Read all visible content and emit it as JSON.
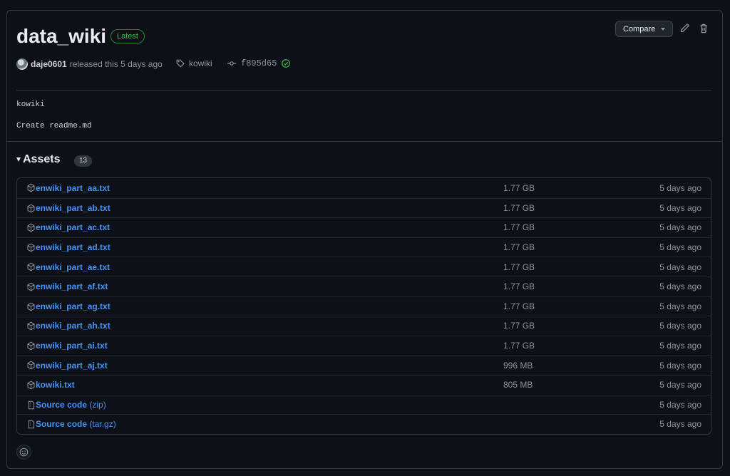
{
  "release": {
    "title": "data_wiki",
    "badge": "Latest",
    "compare_label": "Compare",
    "author": "daje0601",
    "released_text": "released this 5 days ago",
    "tag": "kowiki",
    "commit": "f895d65",
    "notes": [
      "kowiki",
      "Create readme.md"
    ]
  },
  "assets": {
    "heading": "Assets",
    "count": "13",
    "items": [
      {
        "name": "enwiki_part_aa.txt",
        "sub": "",
        "size": "1.77 GB",
        "date": "5 days ago",
        "icon": "package-icon"
      },
      {
        "name": "enwiki_part_ab.txt",
        "sub": "",
        "size": "1.77 GB",
        "date": "5 days ago",
        "icon": "package-icon"
      },
      {
        "name": "enwiki_part_ac.txt",
        "sub": "",
        "size": "1.77 GB",
        "date": "5 days ago",
        "icon": "package-icon"
      },
      {
        "name": "enwiki_part_ad.txt",
        "sub": "",
        "size": "1.77 GB",
        "date": "5 days ago",
        "icon": "package-icon"
      },
      {
        "name": "enwiki_part_ae.txt",
        "sub": "",
        "size": "1.77 GB",
        "date": "5 days ago",
        "icon": "package-icon"
      },
      {
        "name": "enwiki_part_af.txt",
        "sub": "",
        "size": "1.77 GB",
        "date": "5 days ago",
        "icon": "package-icon"
      },
      {
        "name": "enwiki_part_ag.txt",
        "sub": "",
        "size": "1.77 GB",
        "date": "5 days ago",
        "icon": "package-icon"
      },
      {
        "name": "enwiki_part_ah.txt",
        "sub": "",
        "size": "1.77 GB",
        "date": "5 days ago",
        "icon": "package-icon"
      },
      {
        "name": "enwiki_part_ai.txt",
        "sub": "",
        "size": "1.77 GB",
        "date": "5 days ago",
        "icon": "package-icon"
      },
      {
        "name": "enwiki_part_aj.txt",
        "sub": "",
        "size": "996 MB",
        "date": "5 days ago",
        "icon": "package-icon"
      },
      {
        "name": "kowiki.txt",
        "sub": "",
        "size": "805 MB",
        "date": "5 days ago",
        "icon": "package-icon"
      },
      {
        "name": "Source code",
        "sub": "(zip)",
        "size": "",
        "date": "5 days ago",
        "icon": "file-zip-icon"
      },
      {
        "name": "Source code",
        "sub": "(tar.gz)",
        "size": "",
        "date": "5 days ago",
        "icon": "file-zip-icon"
      }
    ]
  },
  "colors": {
    "background": "#0d1117",
    "border": "#30363d",
    "link": "#4493f8",
    "success": "#3fb950",
    "muted": "#8b949e"
  }
}
